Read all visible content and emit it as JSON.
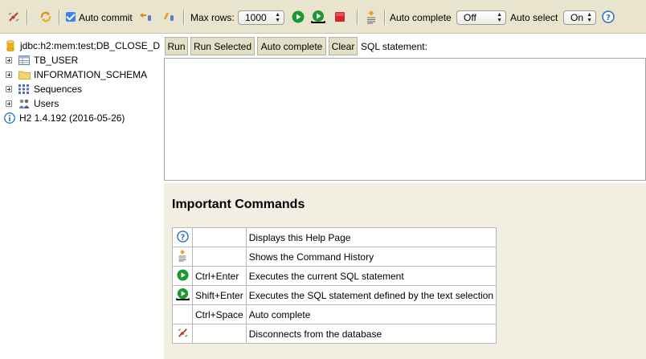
{
  "toolbar": {
    "auto_commit_label": "Auto commit",
    "auto_commit_checked": true,
    "max_rows_label": "Max rows:",
    "max_rows_value": "1000",
    "auto_complete_label": "Auto complete",
    "auto_complete_value": "Off",
    "auto_select_label": "Auto select",
    "auto_select_value": "On",
    "help_glyph": "?"
  },
  "tree": {
    "connection": "jdbc:h2:mem:test;DB_CLOSE_D",
    "items": [
      {
        "label": "TB_USER",
        "icon": "table-icon"
      },
      {
        "label": "INFORMATION_SCHEMA",
        "icon": "folder-icon"
      },
      {
        "label": "Sequences",
        "icon": "sequence-icon"
      },
      {
        "label": "Users",
        "icon": "users-icon"
      }
    ],
    "version": "H2 1.4.192 (2016-05-26)"
  },
  "sql": {
    "buttons": {
      "run": "Run",
      "run_selected": "Run Selected",
      "auto_complete": "Auto complete",
      "clear": "Clear"
    },
    "label": "SQL statement:",
    "value": ""
  },
  "help": {
    "title": "Important Commands",
    "rows": [
      {
        "icon": "help-icon",
        "key": "",
        "desc": "Displays this Help Page"
      },
      {
        "icon": "history-icon",
        "key": "",
        "desc": "Shows the Command History"
      },
      {
        "icon": "run-icon",
        "key": "Ctrl+Enter",
        "desc": "Executes the current SQL statement"
      },
      {
        "icon": "run-selected-icon",
        "key": "Shift+Enter",
        "desc": "Executes the SQL statement defined by the text selection"
      },
      {
        "icon": "",
        "key": "Ctrl+Space",
        "desc": "Auto complete"
      },
      {
        "icon": "disconnect-icon",
        "key": "",
        "desc": "Disconnects from the database"
      }
    ]
  },
  "colors": {
    "toolbar_bg": "#e8e4ce",
    "result_bg": "#f2efe2",
    "run_green": "#1a9a2e",
    "stop_red": "#d6252a",
    "help_blue": "#2d6fc0"
  }
}
